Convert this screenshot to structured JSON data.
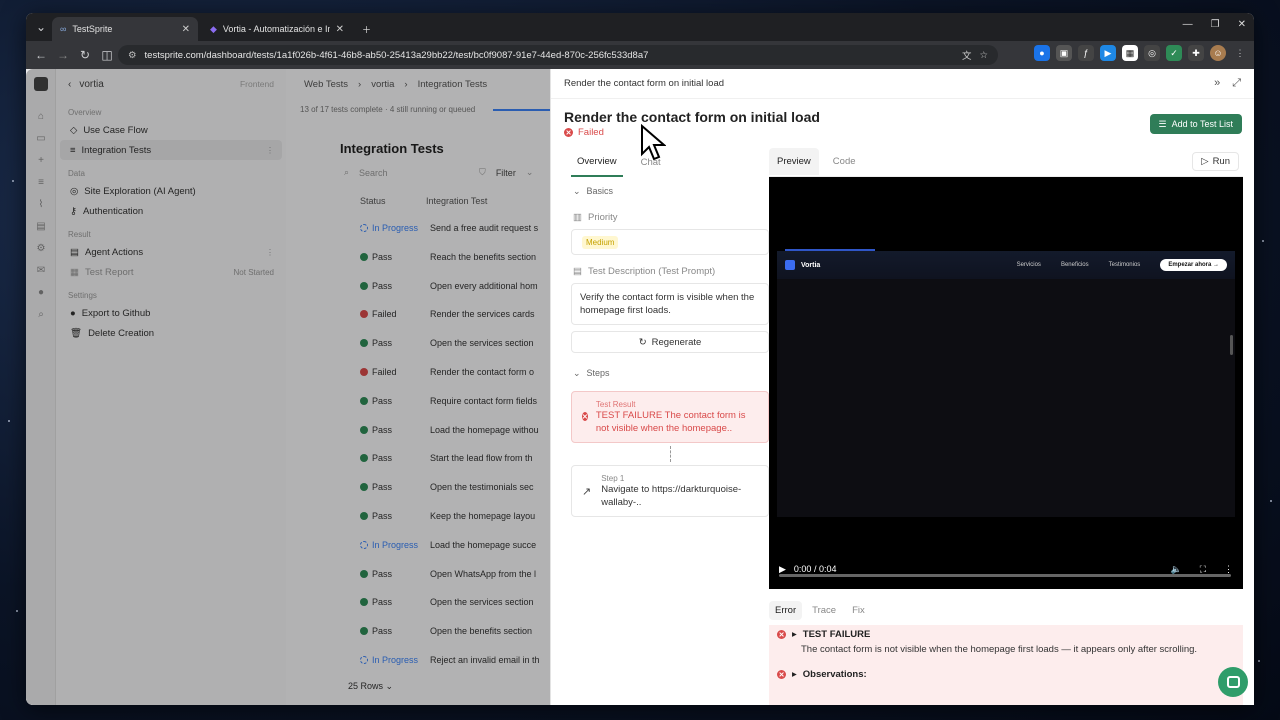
{
  "browser": {
    "tabs": [
      {
        "title": "TestSprite",
        "active": true
      },
      {
        "title": "Vortia - Automatización e Intel",
        "active": false
      }
    ],
    "url": "testsprite.com/dashboard/tests/1a1f026b-4f61-46b8-ab50-25413a29bb22/test/bc0f9087-91e7-44ed-870c-256fc533d8a7"
  },
  "sidebar": {
    "project": "vortia",
    "project_tag": "Frontend",
    "sections": [
      {
        "title": "Overview",
        "items": [
          {
            "label": "Use Case Flow"
          },
          {
            "label": "Integration Tests",
            "active": true
          }
        ]
      },
      {
        "title": "Data",
        "items": [
          {
            "label": "Site Exploration (AI Agent)"
          },
          {
            "label": "Authentication"
          }
        ]
      },
      {
        "title": "Result",
        "items": [
          {
            "label": "Agent Actions"
          },
          {
            "label": "Test Report",
            "badge": "Not Started"
          }
        ]
      },
      {
        "title": "Settings",
        "items": [
          {
            "label": "Export to Github"
          },
          {
            "label": "Delete Creation"
          }
        ]
      }
    ]
  },
  "main": {
    "breadcrumb": [
      "Web Tests",
      "vortia",
      "Integration Tests"
    ],
    "progress_text": "13 of 17 tests complete · 4 still running or queued",
    "heading": "Integration Tests",
    "search_placeholder": "Search",
    "filter_label": "Filter",
    "columns": [
      "Status",
      "Integration Test"
    ],
    "rows": [
      {
        "status": "In Progress",
        "name": "Send a free audit request s"
      },
      {
        "status": "Pass",
        "name": "Reach the benefits section"
      },
      {
        "status": "Pass",
        "name": "Open every additional hom"
      },
      {
        "status": "Failed",
        "name": "Render the services cards"
      },
      {
        "status": "Pass",
        "name": "Open the services section"
      },
      {
        "status": "Failed",
        "name": "Render the contact form o"
      },
      {
        "status": "Pass",
        "name": "Require contact form fields"
      },
      {
        "status": "Pass",
        "name": "Load the homepage withou"
      },
      {
        "status": "Pass",
        "name": "Start the lead flow from th"
      },
      {
        "status": "Pass",
        "name": "Open the testimonials sec"
      },
      {
        "status": "Pass",
        "name": "Keep the homepage layou"
      },
      {
        "status": "In Progress",
        "name": "Load the homepage succe"
      },
      {
        "status": "Pass",
        "name": "Open WhatsApp from the l"
      },
      {
        "status": "Pass",
        "name": "Open the services section"
      },
      {
        "status": "Pass",
        "name": "Open the benefits section"
      },
      {
        "status": "In Progress",
        "name": "Reject an invalid email in th"
      }
    ],
    "rows_per_page": "25 Rows"
  },
  "panel": {
    "header": "Render the contact form on initial load",
    "title": "Render the contact form on initial load",
    "status": "Failed",
    "add_button": "Add to Test List",
    "left_tabs": [
      "Overview",
      "Chat"
    ],
    "basics_label": "Basics",
    "priority_label": "Priority",
    "priority_value": "Medium",
    "description_label": "Test Description (Test Prompt)",
    "description": "Verify the contact form is visible when the homepage first loads.",
    "regenerate_label": "Regenerate",
    "steps_label": "Steps",
    "result_title": "Test Result",
    "result_text": "TEST FAILURE The contact form is not visible when the homepage..",
    "step1_title": "Step 1",
    "step1_text": "Navigate to https://darkturquoise-wallaby-..",
    "right_tabs": [
      "Preview",
      "Code"
    ],
    "run_label": "Run",
    "video": {
      "brand": "Vortia",
      "nav": [
        "Servicios",
        "Beneficios",
        "Testimonios"
      ],
      "cta": "Empezar ahora →",
      "time": "0:00 / 0:04"
    },
    "bottom_tabs": [
      "Error",
      "Trace",
      "Fix"
    ],
    "error_title": "TEST FAILURE",
    "error_text": "The contact form is not visible when the homepage first loads — it appears only after scrolling.",
    "observations": "Observations:"
  },
  "colors": {
    "accent": "#2f7d58",
    "pass": "#2e8b57",
    "failed": "#d94a4a",
    "progress": "#3b82f6"
  }
}
